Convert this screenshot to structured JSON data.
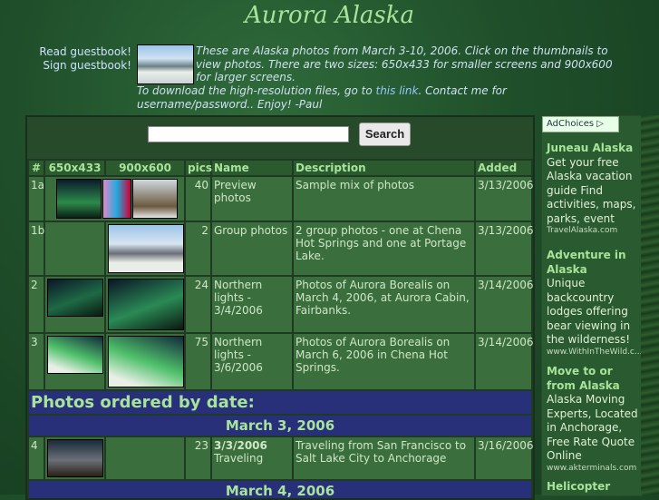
{
  "title": "Aurora Alaska",
  "guestbook": {
    "read": "Read guestbook!",
    "sign": "Sign guestbook!"
  },
  "intro": "These are Alaska photos from March 3-10, 2006. Click on the thumbnails to view photos. There are two sizes: 650x433 for smaller screens and 900x600 for larger screens.",
  "download": {
    "prefix": "To download the high-resolution files, go to",
    "link": "this link",
    "suffix": ". Contact me for username/password.. Enjoy! -Paul"
  },
  "search": {
    "button": "Search",
    "value": ""
  },
  "table": {
    "headers": [
      "#",
      "650x433",
      "900x600",
      "pics",
      "Name",
      "Description",
      "Added"
    ],
    "rows": [
      {
        "id": "1a",
        "pics": "40",
        "name": "Preview photos",
        "desc": "Sample mix of photos",
        "added": "3/13/2006"
      },
      {
        "id": "1b",
        "pics": "2",
        "name": "Group photos",
        "desc": "2 group photos - one at Chena Hot Springs and one at Portage Lake.",
        "added": "3/13/2006"
      },
      {
        "id": "2",
        "pics": "24",
        "name": "Northern lights - 3/4/2006",
        "desc": "Photos of Aurora Borealis on March 4, 2006, at Aurora Cabin, Fairbanks.",
        "added": "3/14/2006"
      },
      {
        "id": "3",
        "pics": "75",
        "name": "Northern lights - 3/6/2006",
        "desc": "Photos of Aurora Borealis on March 6, 2006 in Chena Hot Springs.",
        "added": "3/14/2006"
      }
    ],
    "section_title": "Photos ordered by date:",
    "date1": "March 3, 2006",
    "row4": {
      "id": "4",
      "pics": "23",
      "name_bold": "3/3/2006",
      "name": "Traveling",
      "desc": "Traveling from San Francisco to Salt Lake City to Anchorage",
      "added": "3/16/2006"
    },
    "date2": "March 4, 2006"
  },
  "ads": {
    "label": "AdChoices",
    "items": [
      {
        "title": "Juneau Alaska",
        "body": "Get your free Alaska vacation guide Find activities, maps, parks, event",
        "url": "TravelAlaska.com"
      },
      {
        "title": "Adventure in Alaska",
        "body": "Unique backcountry lodges offering bear viewing in the wilderness!",
        "url": "www.WithInTheWild.c..."
      },
      {
        "title": "Move to or from Alaska",
        "body": "Alaska Moving Experts, Located in Anchorage, Free Rate Quote Online",
        "url": "www.akterminals.com"
      },
      {
        "title": "Helicopter",
        "body": "",
        "url": ""
      }
    ]
  }
}
